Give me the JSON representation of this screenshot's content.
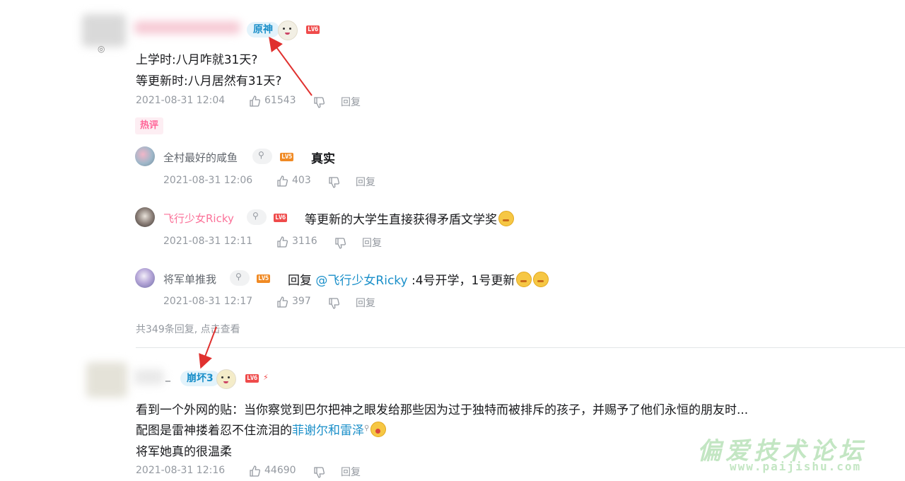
{
  "comment1": {
    "fan_badge": "原神",
    "level": "LV6",
    "lines": [
      "上学时:八月咋就31天?",
      "等更新时:八月居然有31天?"
    ],
    "time": "2021-08-31 12:04",
    "likes": "61543",
    "reply_label": "回复",
    "hot_tag": "热评",
    "replies": [
      {
        "user": "全村最好的咸鱼",
        "level": "LV5",
        "text": "真实",
        "time": "2021-08-31 12:06",
        "likes": "403",
        "reply_label": "回复"
      },
      {
        "user": "飞行少女Ricky",
        "level": "LV6",
        "text": "等更新的大学生直接获得矛盾文学奖",
        "time": "2021-08-31 12:11",
        "likes": "3116",
        "reply_label": "回复"
      },
      {
        "user": "将军单推我",
        "level": "LV5",
        "reply_prefix": "回复",
        "mention": "@飞行少女Ricky",
        "text": ":4号开学，1号更新",
        "time": "2021-08-31 12:17",
        "likes": "397",
        "reply_label": "回复"
      }
    ],
    "more_replies": "共349条回复, 点击查看"
  },
  "comment2": {
    "name_suffix": "_",
    "fan_badge": "崩坏3",
    "level": "LV6",
    "line1": "看到一个外网的贴：当你察觉到巴尔把神之眼发给那些因为过于独特而被排斥的孩子，并赐予了他们永恒的朋友时...",
    "line2_prefix": "配图是雷神搂着忍不住流泪的",
    "line2_link": "菲谢尔和雷泽",
    "line3": "将军她真的很温柔",
    "time": "2021-08-31 12:16",
    "likes": "44690",
    "reply_label": "回复"
  },
  "watermark": {
    "line1": "偏爱技术论坛",
    "line2": "www.paijishu.com"
  },
  "colors": {
    "accent": "#1a8fc9",
    "pink": "#fb7299",
    "arrow": "#e0312f"
  }
}
